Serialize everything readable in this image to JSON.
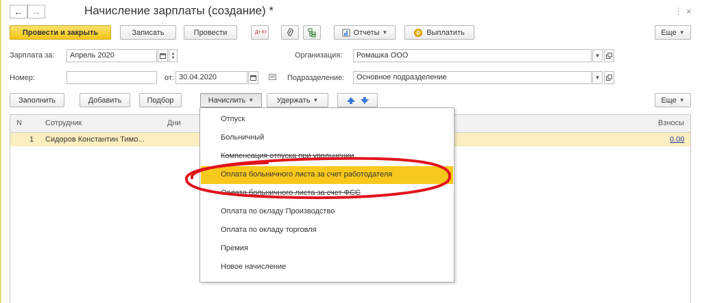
{
  "header": {
    "back_icon": "←",
    "forward_icon": "→",
    "title": "Начисление зарплаты (создание) *",
    "more_icon": "⋮",
    "close_icon": "×"
  },
  "toolbar": {
    "post_close": "Провести и закрыть",
    "save": "Записать",
    "post": "Провести",
    "dtkt_icon": "Дт Кт",
    "attach_icon": "📎",
    "structure_icon": "⊞",
    "reports": "Отчеты",
    "pay": "Выплатить",
    "more": "Еще"
  },
  "form": {
    "salary_for_label": "Зарплата за:",
    "salary_for_value": "Апрель 2020",
    "org_label": "Организация:",
    "org_value": "Ромашка ООО",
    "number_label": "Номер:",
    "number_value": "",
    "date_label": "от:",
    "date_value": "30.04.2020",
    "dept_label": "Подразделение:",
    "dept_value": "Основное подразделение"
  },
  "table_toolbar": {
    "fill": "Заполнить",
    "add": "Добавить",
    "pick": "Подбор",
    "accrue": "Начислить",
    "withhold": "Удержать",
    "more": "Еще"
  },
  "table": {
    "col_n": "N",
    "col_employee": "Сотрудник",
    "col_days": "Дни",
    "col_contrib": "Взносы",
    "rows": [
      {
        "n": "1",
        "employee": "Сидоров Константин Тимо...",
        "contrib": "0.00"
      }
    ]
  },
  "menu": {
    "items": [
      "Отпуск",
      "Больничный",
      "Компенсация отпуска при увольнении",
      "Оплата больничного листа за счет работодателя",
      "Оплата больничного листа за счет ФСС",
      "Оплата по окладу Производство",
      "Оплата по окладу торговля",
      "Премия",
      "Новое начисление"
    ]
  },
  "colors": {
    "highlight": "#f8c91c",
    "annotation_ellipse": "#e0141c",
    "selected_row": "#fbeec0"
  }
}
